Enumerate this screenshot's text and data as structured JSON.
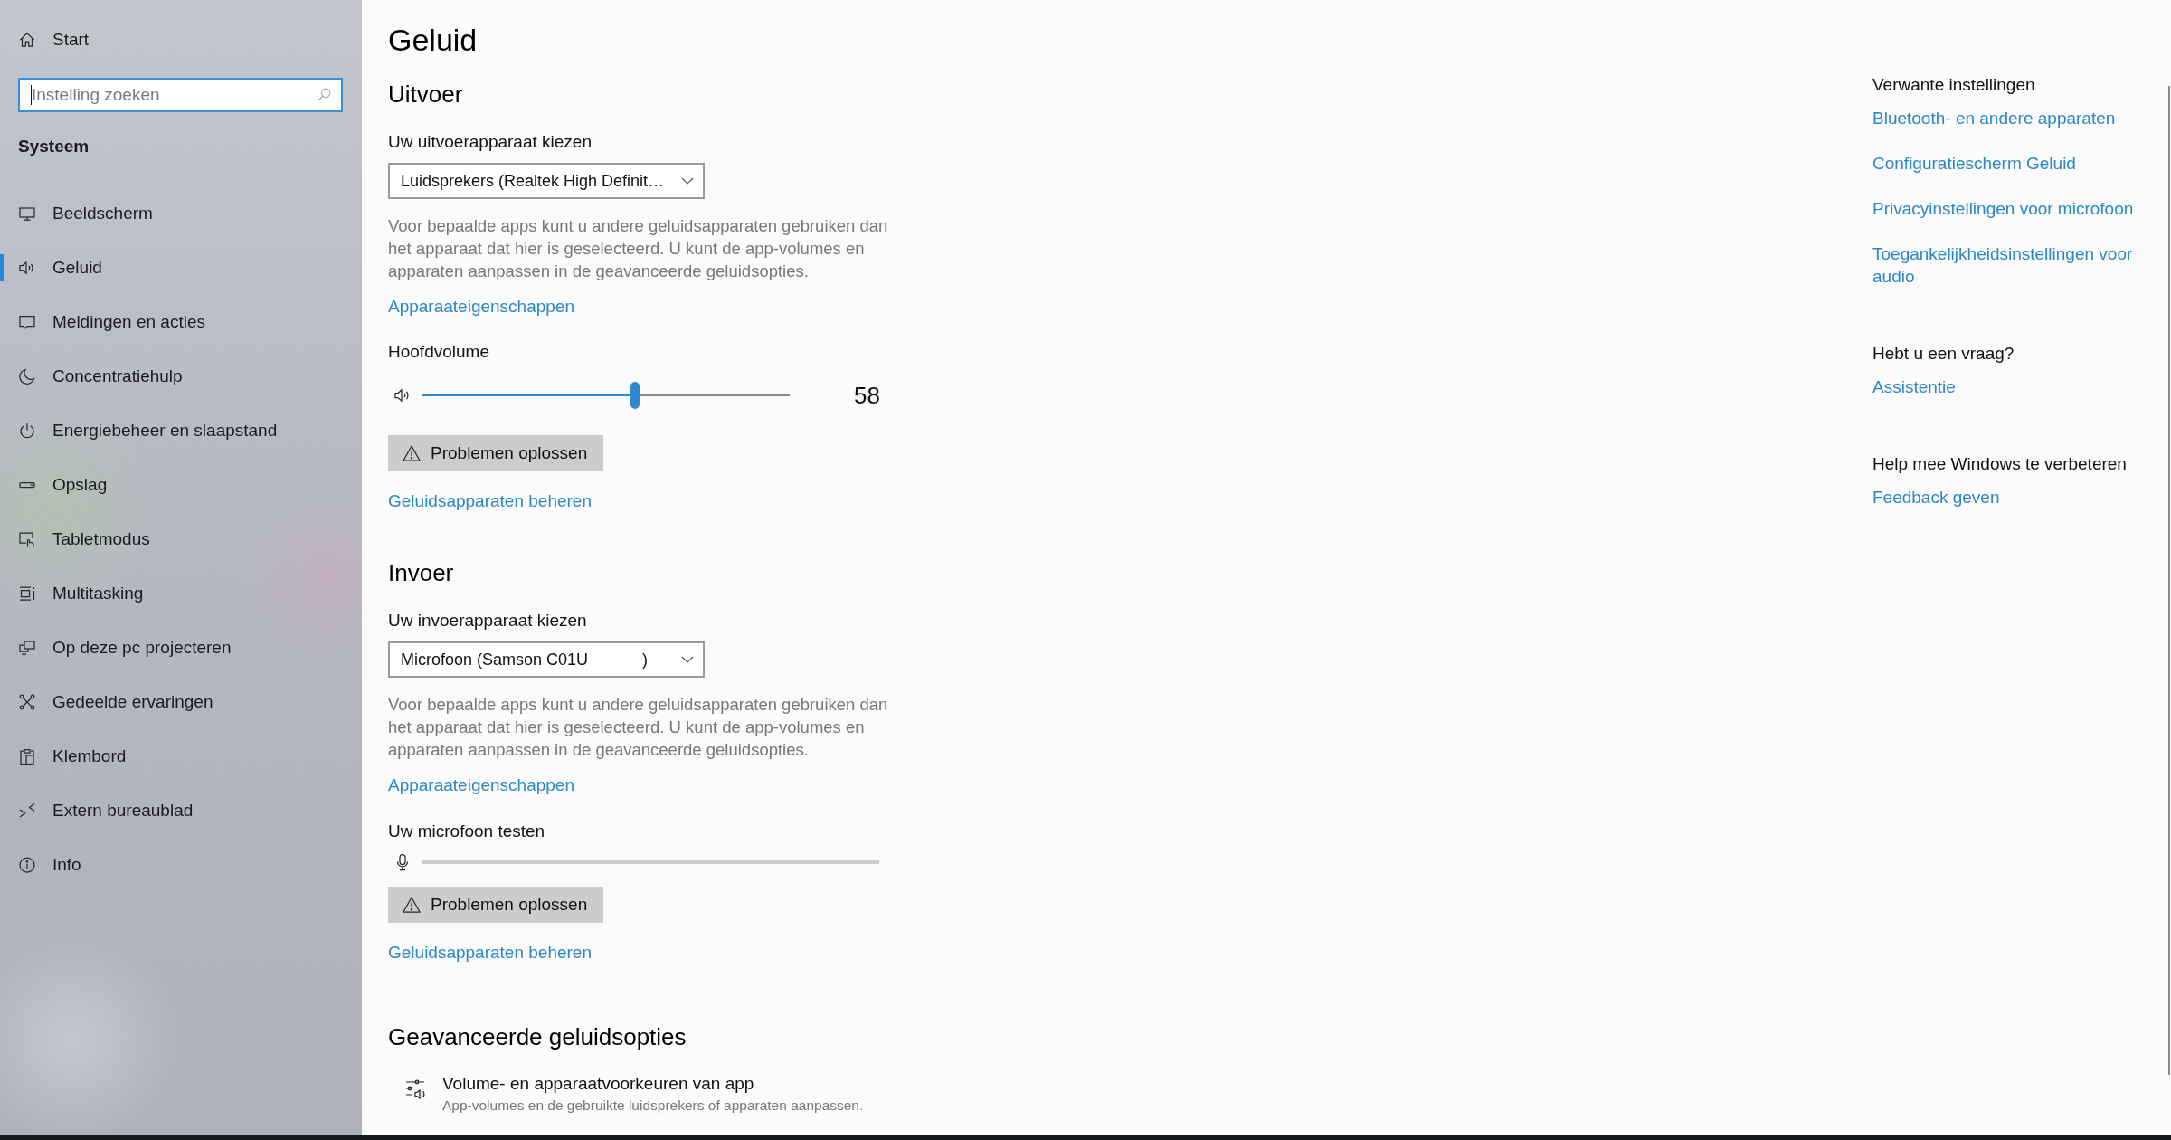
{
  "sidebar": {
    "home_link": "Start",
    "search": {
      "placeholder": "Instelling zoeken",
      "focused": true
    },
    "section_title": "Systeem",
    "items": [
      {
        "label": "Beeldscherm",
        "selected": false
      },
      {
        "label": "Geluid",
        "selected": true
      },
      {
        "label": "Meldingen en acties",
        "selected": false
      },
      {
        "label": "Concentratiehulp",
        "selected": false
      },
      {
        "label": "Energiebeheer en slaapstand",
        "selected": false
      },
      {
        "label": "Opslag",
        "selected": false
      },
      {
        "label": "Tabletmodus",
        "selected": false
      },
      {
        "label": "Multitasking",
        "selected": false
      },
      {
        "label": "Op deze pc projecteren",
        "selected": false
      },
      {
        "label": "Gedeelde ervaringen",
        "selected": false
      },
      {
        "label": "Klembord",
        "selected": false
      },
      {
        "label": "Extern bureaublad",
        "selected": false
      },
      {
        "label": "Info",
        "selected": false
      }
    ]
  },
  "page_title": "Geluid",
  "output": {
    "heading": "Uitvoer",
    "device_label": "Uw uitvoerapparaat kiezen",
    "device_value": "Luidsprekers (Realtek High Definit…",
    "description": "Voor bepaalde apps kunt u andere geluidsapparaten gebruiken dan het apparaat dat hier is geselecteerd. U kunt de app-volumes en apparaten aanpassen in de geavanceerde geluidsopties.",
    "properties_link": "Apparaateigenschappen",
    "volume": {
      "label": "Hoofdvolume",
      "level": 0.58,
      "reading": "58"
    },
    "troubleshoot_button": "Problemen oplossen",
    "manage_link": "Geluidsapparaten beheren"
  },
  "input": {
    "heading": "Invoer",
    "device_label": "Uw invoerapparaat kiezen",
    "device_value": "Microfoon (Samson C01U            )",
    "description": "Voor bepaalde apps kunt u andere geluidsapparaten gebruiken dan het apparaat dat hier is geselecteerd. U kunt de app-volumes en apparaten aanpassen in de geavanceerde geluidsopties.",
    "properties_link": "Apparaateigenschappen",
    "mic_test": {
      "label": "Uw microfoon testen",
      "level": 0
    },
    "troubleshoot_button": "Problemen oplossen",
    "manage_link": "Geluidsapparaten beheren"
  },
  "advanced": {
    "heading": "Geavanceerde geluidsopties",
    "items": [
      {
        "title": "Volume- en apparaatvoorkeuren van app",
        "description": "App-volumes en de gebruikte luidsprekers of apparaten aanpassen."
      }
    ]
  },
  "related": [
    {
      "heading": "Verwante instellingen",
      "links": [
        "Bluetooth- en andere apparaten",
        "Configuratiescherm Geluid",
        "Privacyinstellingen voor microfoon",
        "Toegankelijkheidsinstellingen voor audio"
      ]
    },
    {
      "heading": "Hebt u een vraag?",
      "links": [
        "Assistentie"
      ]
    },
    {
      "heading": "Help mee Windows te verbeteren",
      "links": [
        "Feedback geven"
      ]
    }
  ]
}
